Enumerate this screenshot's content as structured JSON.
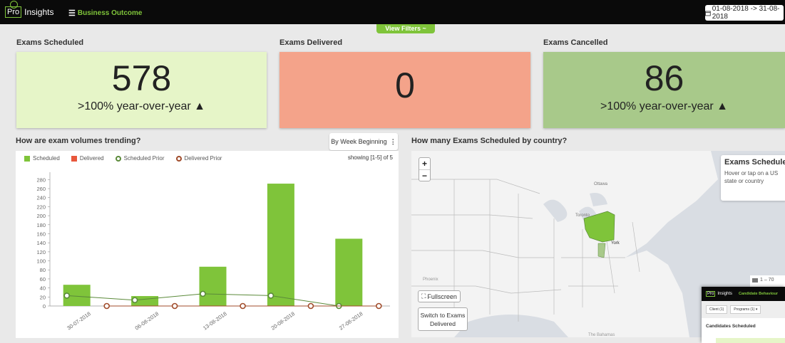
{
  "topbar": {
    "logo_box": "Pro",
    "logo_text": "Insights",
    "menu_label": "Business Outcome",
    "date_range": "01-08-2018 -> 31-08-2018"
  },
  "filters_label": "View Filters ~",
  "kpis": [
    {
      "title": "Exams Scheduled",
      "value": "578",
      "sub": ">100% year-over-year ▲",
      "color": "#e6f5c8"
    },
    {
      "title": "Exams Delivered",
      "value": "0",
      "sub": "",
      "color": "#f4a38a"
    },
    {
      "title": "Exams Cancelled",
      "value": "86",
      "sub": ">100% year-over-year ▲",
      "color": "#a8c98a"
    }
  ],
  "trend": {
    "title": "How are exam volumes trending?",
    "group_button": "By Week Beginning",
    "showing": "showing [1-5] of 5",
    "legend": [
      "Scheduled",
      "Delivered",
      "Scheduled Prior",
      "Delivered Prior"
    ]
  },
  "chart_data": {
    "type": "bar",
    "categories": [
      "30-07-2018",
      "06-08-2018",
      "13-08-2018",
      "20-08-2018",
      "27-08-2018"
    ],
    "yticks": [
      0,
      20,
      40,
      60,
      80,
      100,
      120,
      140,
      160,
      180,
      200,
      220,
      240,
      260,
      280
    ],
    "ylim": [
      0,
      290
    ],
    "series": [
      {
        "name": "Scheduled",
        "type": "bar",
        "color": "#7fc43a",
        "values": [
          47,
          22,
          87,
          271,
          149
        ]
      },
      {
        "name": "Delivered",
        "type": "bar",
        "color": "#e8573c",
        "values": [
          0,
          0,
          0,
          0,
          0
        ]
      },
      {
        "name": "Scheduled Prior",
        "type": "line",
        "color": "#5b8a3a",
        "values": [
          23,
          13,
          27,
          23,
          0
        ]
      },
      {
        "name": "Delivered Prior",
        "type": "line",
        "color": "#a04b2a",
        "values": [
          0,
          0,
          0,
          0,
          0
        ]
      }
    ]
  },
  "map": {
    "title": "How many Exams Scheduled by country?",
    "zoom_in": "+",
    "zoom_out": "−",
    "info_title": "Exams Scheduled",
    "info_text": "Hover or tap on a US state or country",
    "fullscreen_label": "Fullscreen",
    "switch_label": "Switch to Exams Delivered",
    "legend_range": "1 – 70",
    "labels": {
      "ottawa": "Ottawa",
      "toronto": "Toronto",
      "york": "York",
      "phoenix": "Phoenix",
      "bahamas": "The Bahamas"
    }
  },
  "thumbnail": {
    "logo_box": "Pro",
    "logo_text": "Insights",
    "menu_label": "Candidate Behaviour",
    "filter1": "Client (1)",
    "filter2": "Programs (1) ▾",
    "label": "Candidates Scheduled"
  }
}
